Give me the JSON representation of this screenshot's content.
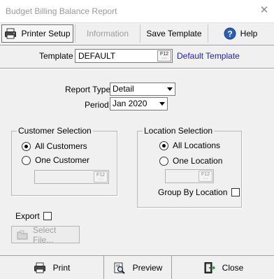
{
  "window": {
    "title": "Budget Billing Balance Report",
    "close_glyph": "✕"
  },
  "toolbar": {
    "printer_setup_label": "Printer Setup",
    "information_label": "Information",
    "save_template_label": "Save Template",
    "help_label": "Help"
  },
  "template": {
    "label": "Template",
    "value": "DEFAULT",
    "lookup_key": "F12",
    "description": "Default Template"
  },
  "report_type": {
    "label": "Report Type",
    "value": "Detail"
  },
  "period": {
    "label": "Period",
    "value": "Jan 2020"
  },
  "customer_selection": {
    "legend": "Customer Selection",
    "options": [
      "All Customers",
      "One Customer"
    ],
    "selected": "All Customers",
    "lookup_key": "F12"
  },
  "location_selection": {
    "legend": "Location Selection",
    "options": [
      "All Locations",
      "One Location"
    ],
    "selected": "All Locations",
    "lookup_key": "F12",
    "group_by_label": "Group By Location",
    "group_by_checked": false
  },
  "export": {
    "label": "Export",
    "checked": false,
    "select_file_label": "Select File..."
  },
  "actions": {
    "print_label": "Print",
    "preview_label": "Preview",
    "close_label": "Close"
  },
  "colors": {
    "link_blue": "#1f1fa8",
    "disabled_text": "#9c9c9c"
  }
}
